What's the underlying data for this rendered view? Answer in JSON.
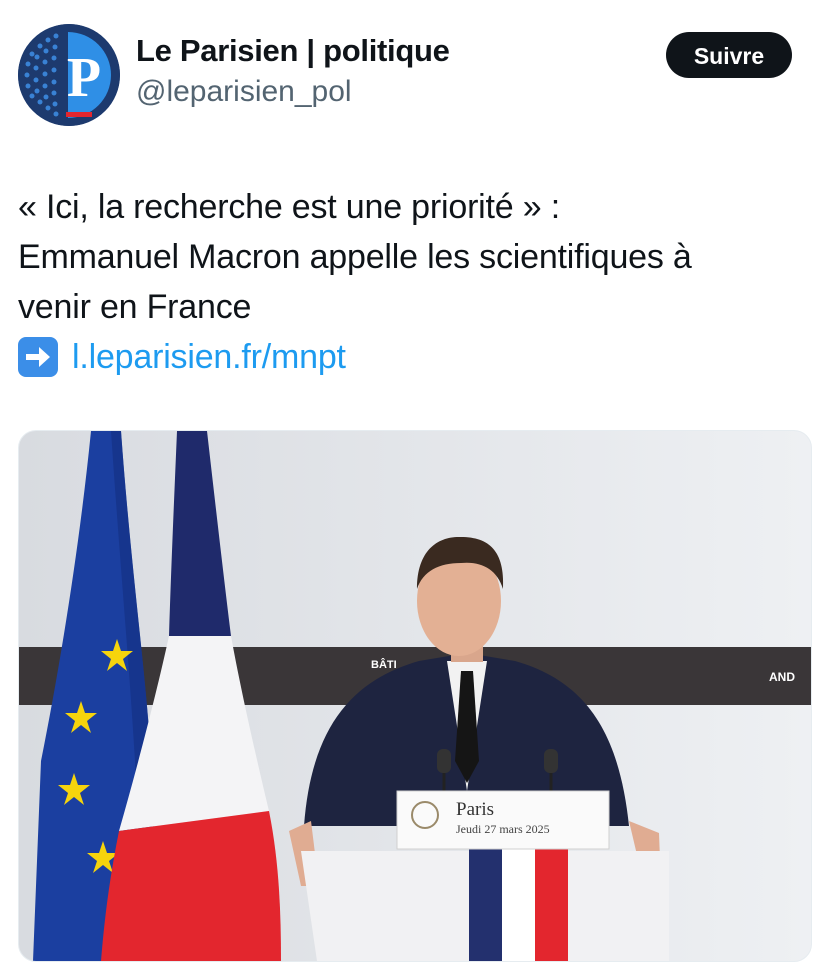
{
  "account": {
    "display_name": "Le Parisien | politique",
    "handle": "@leparisien_pol",
    "avatar_letter": "P"
  },
  "follow_button": {
    "label": "Suivre"
  },
  "tweet": {
    "lines": [
      "« Ici, la recherche est une priorité » :",
      "Emmanuel Macron appelle les scientifiques à",
      "venir en France"
    ],
    "link_text": "l.leparisien.fr/mnpt"
  },
  "photo": {
    "banner_left": "BÂTI",
    "banner_right": "AND",
    "podium_city": "Paris",
    "podium_date": "Jeudi 27 mars 2025"
  },
  "colors": {
    "accent_link": "#1d9bf0",
    "button_bg": "#0f1419",
    "eu_blue": "#1b3fa0",
    "french_blue": "#1f2a6b",
    "french_red": "#e3262e"
  }
}
